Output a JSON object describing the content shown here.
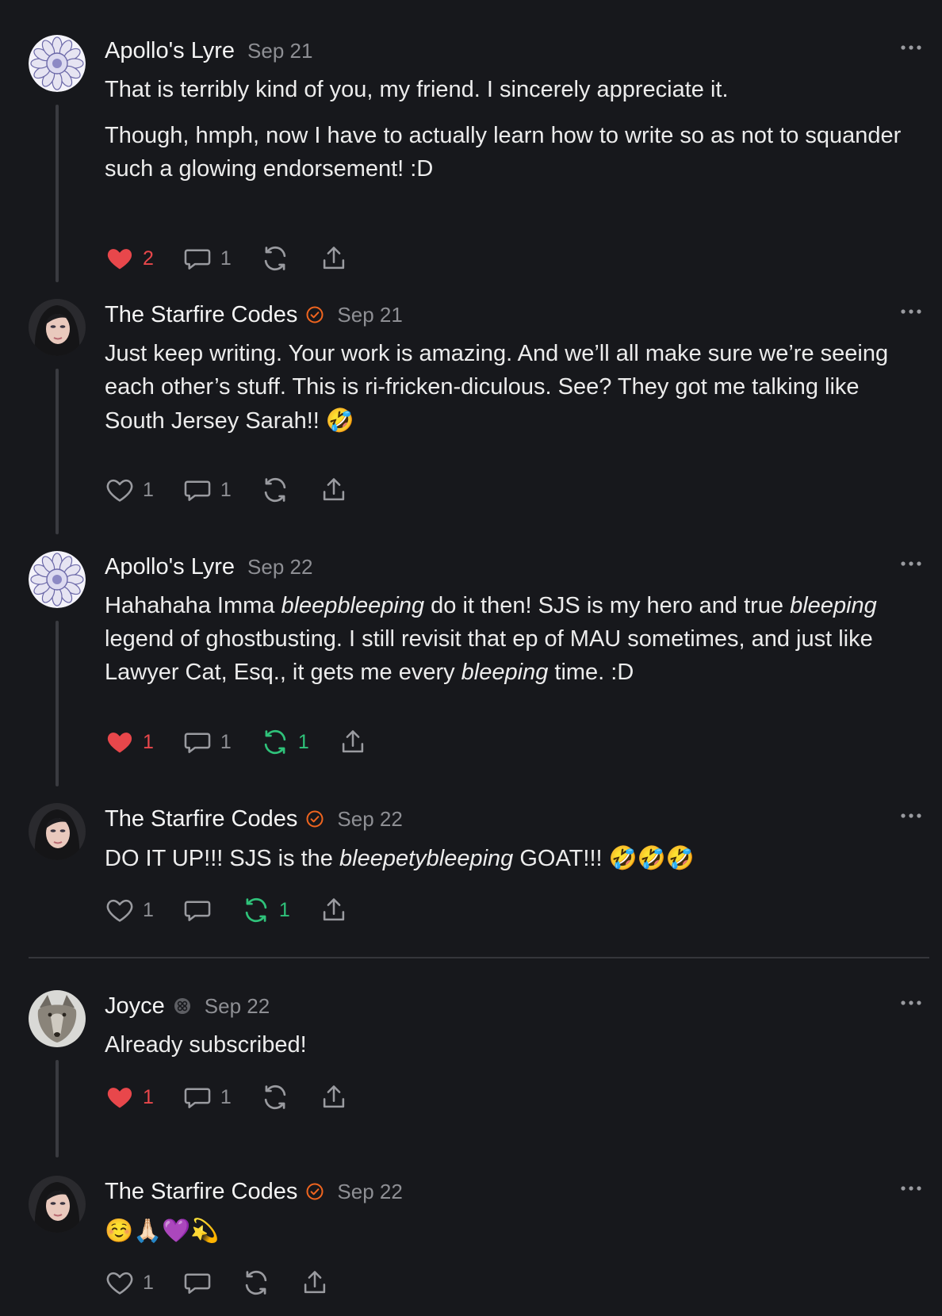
{
  "colors": {
    "background": "#17181c",
    "like": "#e8474b",
    "restack": "#2fc27a",
    "verified_badge": "#f0651f",
    "muted": "#8e8f94"
  },
  "comments": [
    {
      "author": "Apollo's Lyre",
      "date": "Sep 21",
      "avatar": "mandala-avatar",
      "badge": null,
      "paragraphs": [
        [
          {
            "t": "That is terribly kind of you, my friend. I sincerely appreciate it."
          }
        ],
        [
          {
            "t": "Though, hmph, now I have to actually learn how to write so as not to squander such a glowing endorsement! :D"
          }
        ]
      ],
      "likes": "2",
      "liked": true,
      "replies": "1",
      "restacks": "",
      "restacked": false
    },
    {
      "author": "The Starfire Codes",
      "date": "Sep 21",
      "avatar": "portrait-avatar",
      "badge": "verified-check-icon",
      "paragraphs": [
        [
          {
            "t": "Just keep writing. Your work is amazing. And we’ll all make sure we’re seeing each other’s stuff. This is ri-fricken-diculous. See? They got me talking like South Jersey Sarah!! "
          },
          {
            "t": "🤣",
            "e": true
          }
        ]
      ],
      "likes": "1",
      "liked": false,
      "replies": "1",
      "restacks": "",
      "restacked": false
    },
    {
      "author": "Apollo's Lyre",
      "date": "Sep 22",
      "avatar": "mandala-avatar",
      "badge": null,
      "paragraphs": [
        [
          {
            "t": "Hahahaha Imma "
          },
          {
            "t": "bleepbleeping",
            "i": true
          },
          {
            "t": " do it then! SJS is my hero and true "
          },
          {
            "t": "bleeping",
            "i": true
          },
          {
            "t": " legend of ghostbusting. I still revisit that ep of MAU sometimes, and just like Lawyer Cat, Esq., it gets me every "
          },
          {
            "t": "bleeping",
            "i": true
          },
          {
            "t": " time. :D"
          }
        ]
      ],
      "likes": "1",
      "liked": true,
      "replies": "1",
      "restacks": "1",
      "restacked": true
    },
    {
      "author": "The Starfire Codes",
      "date": "Sep 22",
      "avatar": "portrait-avatar",
      "badge": "verified-check-icon",
      "paragraphs": [
        [
          {
            "t": "DO IT UP!!! SJS is the "
          },
          {
            "t": "bleepetybleeping",
            "i": true
          },
          {
            "t": " GOAT!!! "
          },
          {
            "t": "🤣🤣🤣",
            "e": true
          }
        ]
      ],
      "likes": "1",
      "liked": false,
      "replies": "",
      "restacks": "1",
      "restacked": true
    },
    {
      "author": "Joyce",
      "date": "Sep 22",
      "avatar": "wolf-avatar",
      "badge": "subscriber-icon",
      "paragraphs": [
        [
          {
            "t": "Already subscribed!"
          }
        ]
      ],
      "likes": "1",
      "liked": true,
      "replies": "1",
      "restacks": "",
      "restacked": false
    },
    {
      "author": "The Starfire Codes",
      "date": "Sep 22",
      "avatar": "portrait-avatar",
      "badge": "verified-check-icon",
      "paragraphs": [
        [
          {
            "t": "☺️🙏🏻💜💫",
            "e": true
          }
        ]
      ],
      "likes": "1",
      "liked": false,
      "replies": "",
      "restacks": "",
      "restacked": false
    }
  ]
}
